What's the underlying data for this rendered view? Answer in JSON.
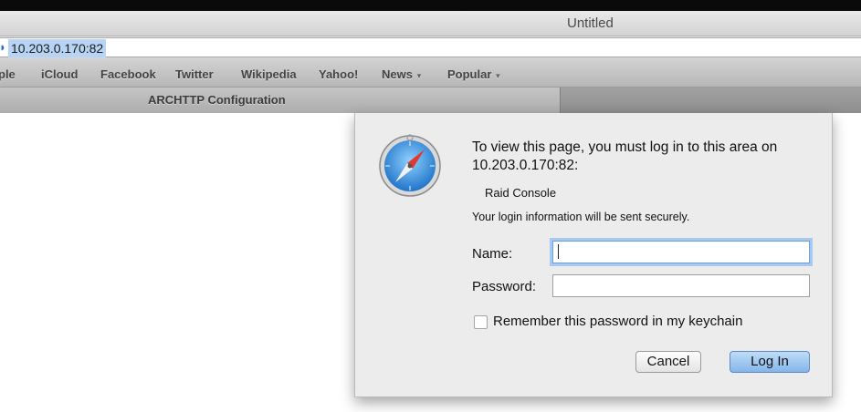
{
  "window": {
    "title": "Untitled"
  },
  "address_bar": {
    "url": "10.203.0.170:82",
    "icon": "globe-icon"
  },
  "bookmarks": [
    {
      "label": "ple"
    },
    {
      "label": "iCloud"
    },
    {
      "label": "Facebook"
    },
    {
      "label": "Twitter"
    },
    {
      "label": "Wikipedia"
    },
    {
      "label": "Yahoo!"
    },
    {
      "label": "News",
      "arrow": "▼"
    },
    {
      "label": "Popular",
      "arrow": "▼"
    }
  ],
  "tab": {
    "label": "ARCHTTP Configuration"
  },
  "auth_dialog": {
    "icon": "safari-compass-icon",
    "message": "To view this page, you must log in to this area on 10.203.0.170:82:",
    "realm": "Raid Console",
    "secure_note": "Your login information will be sent securely.",
    "name_label": "Name:",
    "name_value": "",
    "password_label": "Password:",
    "password_value": "",
    "remember_label": "Remember this password in my keychain",
    "remember_checked": false,
    "cancel_label": "Cancel",
    "login_label": "Log In",
    "accent_color": "#84b6ea"
  }
}
